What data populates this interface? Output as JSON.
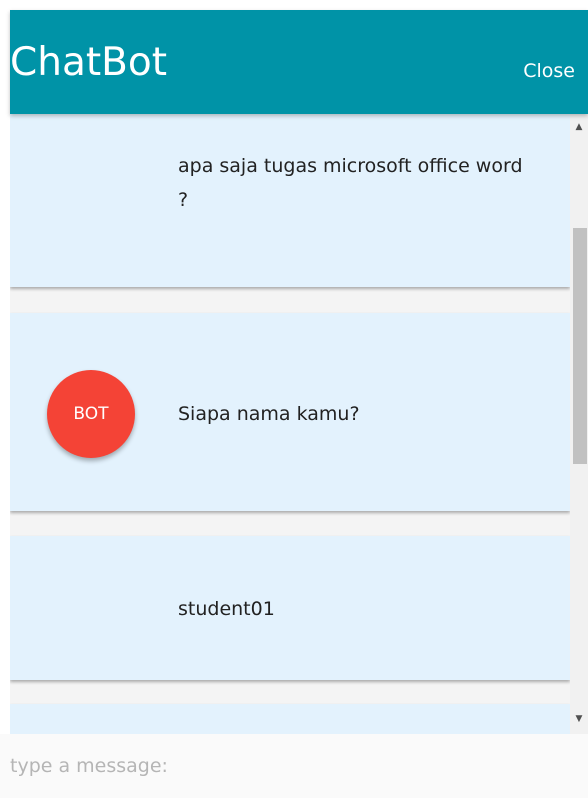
{
  "header": {
    "title": "ChatBot",
    "close_label": "Close"
  },
  "messages": [
    {
      "sender": "user",
      "text": "apa saja tugas microsoft office word ?"
    },
    {
      "sender": "bot",
      "avatar_label": "BOT",
      "text": "Siapa nama kamu?"
    },
    {
      "sender": "user",
      "text": "student01"
    },
    {
      "sender": "unknown",
      "text": ""
    }
  ],
  "input": {
    "placeholder": "type a message:",
    "value": ""
  },
  "colors": {
    "header_bg": "#0093a7",
    "card_bg": "#e3f2fd",
    "bot_avatar": "#f44336"
  },
  "icons": {
    "scroll_up": "triangle-up-icon",
    "scroll_down": "triangle-down-icon"
  }
}
